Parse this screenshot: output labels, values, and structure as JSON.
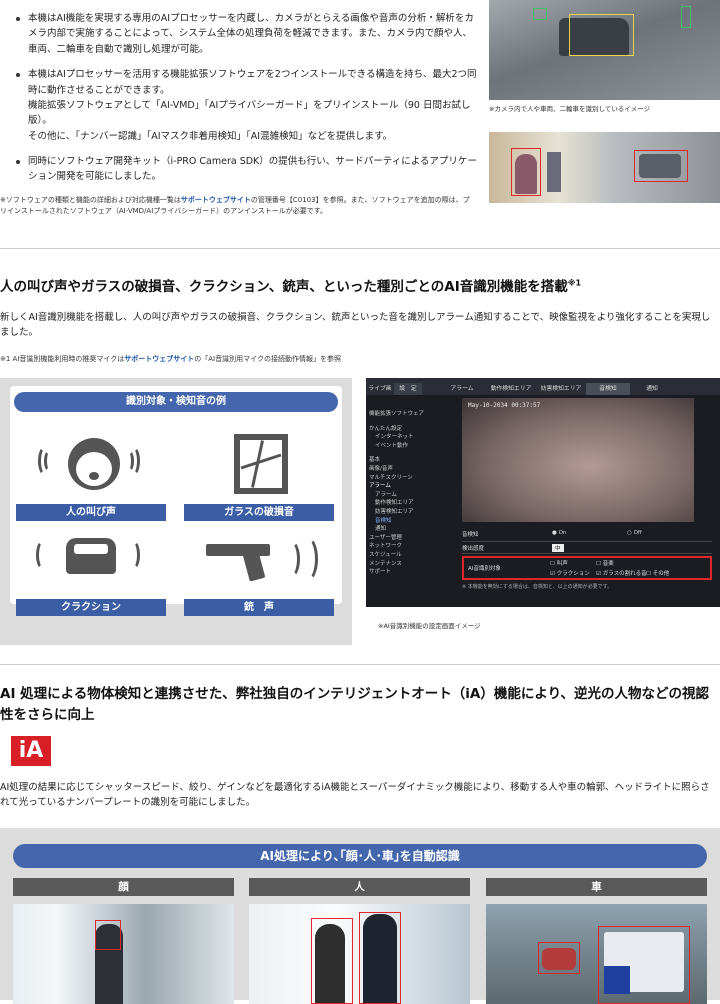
{
  "features": {
    "items": [
      {
        "text": "本機はAI機能を実現する専用のAIプロセッサーを内蔵し、カメラがとらえる画像や音声の分析・解析をカメラ内部で実施することによって、システム全体の処理負荷を軽減できます。また、カメラ内で顔や人、車両、二輪車を自動で識別し処理が可能。"
      },
      {
        "text": "本機はAIプロセッサーを活用する機能拡張ソフトウェアを2つインストールできる構造を持ち、最大2つ同時に動作させることができます。",
        "sub1": "機能拡張ソフトウェアとして「AI-VMD」「AIプライバシーガード」をプリインストール（90 日間お試し版）。",
        "sub2": "その他に、「ナンバー認識」「AIマスク非着用検知」「AI混雑検知」などを提供します。"
      },
      {
        "text": "同時にソフトウェア開発キット（i-PRO Camera SDK）の提供も行い、サードパーティによるアプリケーション開発を可能にしました。"
      }
    ],
    "note_pre": "※ソフトウェアの種類と機能の詳細および対応機種一覧は",
    "note_link": "サポートウェブサイト",
    "note_post": "の管理番号【C0103】を参照。また、ソフトウェアを追加の際は、プリインストールされたソフトウェア（AI-VMD/AIプライバシーガード）のアンインストールが必要です。"
  },
  "top_image": {
    "caption": "※カメラ内で人や車両、二輪車を識別しているイメージ"
  },
  "audio": {
    "heading": "人の叫び声やガラスの破損音、クラクション、銃声、といった種別ごとのAI音識別機能を搭載",
    "heading_sup": "※1",
    "body": "新しくAI音識別機能を搭載し、人の叫び声やガラスの破損音、クラクション、銃声といった音を識別しアラーム通知することで、映像監視をより強化することを実現しました。",
    "note_pre": "※1 AI音識別機能利用時の推奨マイクは",
    "note_link": "サポートウェブサイト",
    "note_post": "の「AI音識別用マイクの接続動作情報」を参照",
    "panel_title": "識別対象・検知音の例",
    "labels": [
      "人の叫び声",
      "ガラスの破損音",
      "クラクション",
      "銃　声"
    ],
    "screen_caption": "※AI音識別機能の設定画面イメージ"
  },
  "settings_ui": {
    "top_tabs": [
      "ライブ画",
      "設　定"
    ],
    "tabs": [
      "アラーム",
      "動作検知エリア",
      "妨害検知エリア",
      "音検知",
      "通知"
    ],
    "timestamp": "May-10-2034 00:37:57",
    "side_items": [
      "機能拡張ソフトウェア",
      "かんたん設定",
      "インターネット",
      "イベント動作",
      "基本",
      "画像/音声",
      "マルチスクリーン",
      "アラーム",
      "アラーム",
      "動作検知エリア",
      "妨害検知エリア",
      "音検知",
      "通知",
      "ユーザー管理",
      "ネットワーク",
      "スケジュール",
      "メンテナンス",
      "サポート"
    ],
    "rows": [
      {
        "label": "音検知",
        "on": "On",
        "off": "Off"
      },
      {
        "label": "検出感度",
        "value": "中"
      },
      {
        "label": "AI音識別対象",
        "opts": [
          "叫声",
          "音楽",
          "クラクション",
          "ガラスの割れる音",
          "その他"
        ]
      }
    ],
    "footnote": "※ 本機能を無効にする場合は、音検知と、以上の通知が必要です。"
  },
  "ia": {
    "heading": "AI 処理による物体検知と連携させた、弊社独自のインテリジェントオート（iA）機能により、逆光の人物などの視認性をさらに向上",
    "logo": "iA",
    "body": "AI処理の結果に応じてシャッタースピード、絞り、ゲインなどを最適化するiA機能とスーパーダイナミック機能により、移動する人や車の輪郭、ヘッドライトに照らされて光っているナンバープレートの識別を可能にしました。"
  },
  "bottom": {
    "banner": "AI処理により､｢顔･人･車｣を自動認識",
    "tags": [
      "顔",
      "人",
      "車"
    ]
  },
  "colors": {
    "accent_blue": "#4466ad",
    "alert_red": "#d81f26",
    "link": "#1e52a8"
  }
}
